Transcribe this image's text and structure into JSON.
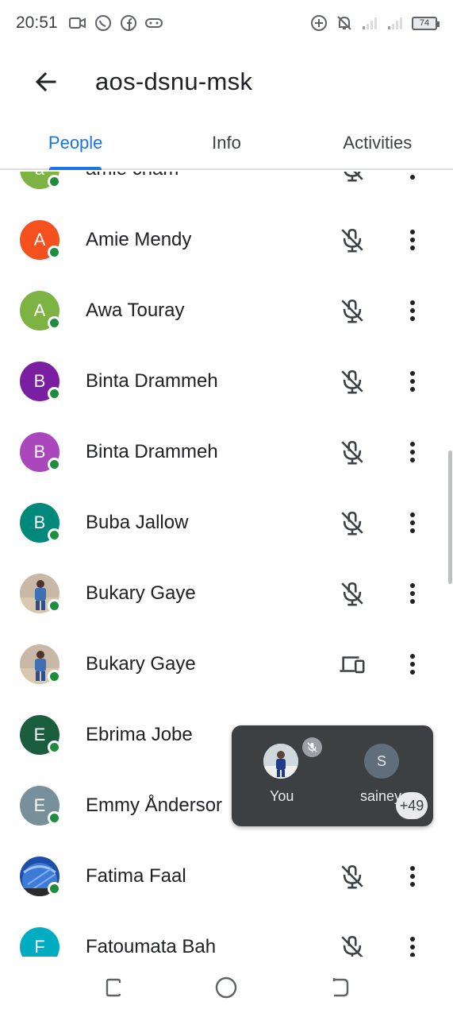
{
  "status_bar": {
    "time": "20:51",
    "battery": "74",
    "icons_left": [
      "video-call-icon",
      "whatsapp-icon",
      "facebook-icon",
      "game-controller-icon"
    ],
    "icons_right": [
      "add-circle-icon",
      "notifications-off-icon",
      "signal-weak-icon",
      "signal-weak-icon",
      "battery-icon"
    ]
  },
  "app_bar": {
    "title": "aos-dsnu-msk"
  },
  "tabs": [
    {
      "label": "People",
      "active": true
    },
    {
      "label": "Info",
      "active": false
    },
    {
      "label": "Activities",
      "active": false
    }
  ],
  "participants": [
    {
      "name": "amie cham",
      "initial": "a",
      "color": "#7cb342",
      "status": "mic-off-icon",
      "online": true
    },
    {
      "name": "Amie Mendy",
      "initial": "A",
      "color": "#f4511e",
      "status": "mic-off-icon",
      "online": true
    },
    {
      "name": "Awa Touray",
      "initial": "A",
      "color": "#7cb342",
      "status": "mic-off-icon",
      "online": true
    },
    {
      "name": "Binta Drammeh",
      "initial": "B",
      "color": "#7b1fa2",
      "status": "mic-off-icon",
      "online": true
    },
    {
      "name": "Binta Drammeh",
      "initial": "B",
      "color": "#ab47bc",
      "status": "mic-off-icon",
      "online": true
    },
    {
      "name": "Buba Jallow",
      "initial": "B",
      "color": "#00897b",
      "status": "mic-off-icon",
      "online": true
    },
    {
      "name": "Bukary Gaye",
      "initial": "",
      "color": "",
      "photo": true,
      "status": "mic-off-icon",
      "online": true
    },
    {
      "name": "Bukary Gaye",
      "initial": "",
      "color": "",
      "photo": true,
      "status": "devices-icon",
      "online": true
    },
    {
      "name": "Ebrima Jobe",
      "initial": "E",
      "color": "#1b5e3f",
      "status": "mic-off-icon",
      "online": true
    },
    {
      "name": "Emmy Åndersor",
      "initial": "E",
      "color": "#78909c",
      "status": "mic-off-icon",
      "online": true
    },
    {
      "name": "Fatima Faal",
      "initial": "",
      "color": "",
      "photo": true,
      "status": "mic-off-icon",
      "online": true
    },
    {
      "name": "Fatoumata Bah",
      "initial": "F",
      "color": "#00acc1",
      "status": "mic-off-icon",
      "online": false
    }
  ],
  "pip": {
    "you_label": "You",
    "other_initial": "S",
    "other_label": "sainey",
    "more_count": "+49"
  },
  "nav_bar": {
    "buttons": [
      "recent-apps-icon",
      "home-icon",
      "back-gesture-icon"
    ]
  }
}
